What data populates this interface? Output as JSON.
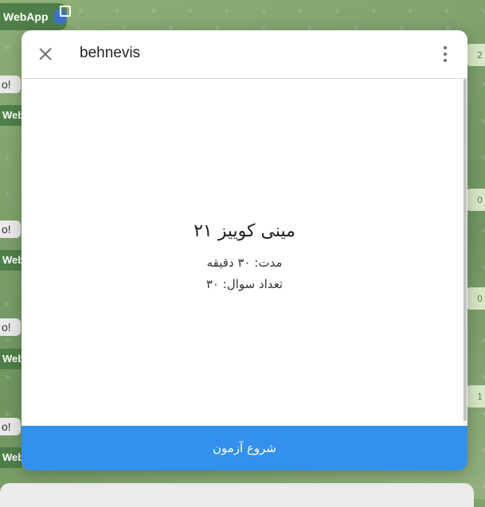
{
  "chat": {
    "top_badge": "WebApp",
    "left_bubbles": [
      "o!",
      "o!",
      "o!",
      "o!"
    ],
    "left_web_labels": [
      "Web",
      "Web",
      "Web",
      "Web"
    ],
    "right_counts": [
      "2",
      "0",
      "0",
      "1"
    ]
  },
  "webapp": {
    "title": "behnevis",
    "quiz": {
      "title": "مینی کوییز ۲۱",
      "duration": "مدت: ۳۰ دقیقه",
      "question_count": "تعداد سوال: ۳۰"
    },
    "start_button_label": "شروع آزمون"
  },
  "colors": {
    "accent": "#3390ec",
    "header_border": "#d8d8d8",
    "chat_bubble_green": "#4f7f48"
  }
}
